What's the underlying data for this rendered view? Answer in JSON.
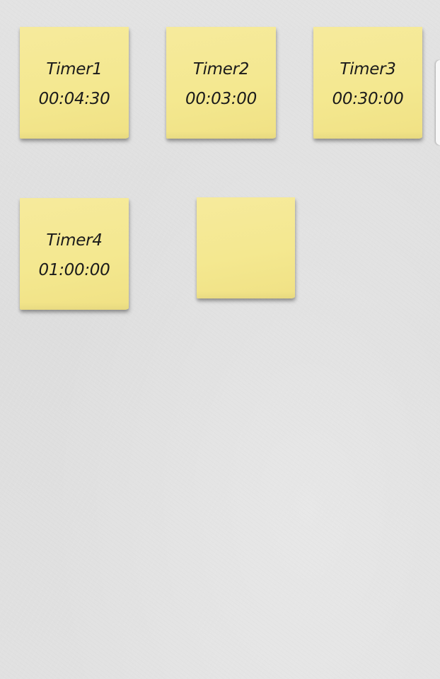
{
  "notes": [
    {
      "title": "Timer1",
      "time": "00:04:30"
    },
    {
      "title": "Timer2",
      "time": "00:03:00"
    },
    {
      "title": "Timer3",
      "time": "00:30:00"
    },
    {
      "title": "Timer4",
      "time": "01:00:00"
    },
    {
      "title": "",
      "time": ""
    }
  ],
  "colors": {
    "note_yellow": "#f4e890",
    "wall_gray": "#e0e0e0",
    "text": "#1b1b1b"
  }
}
